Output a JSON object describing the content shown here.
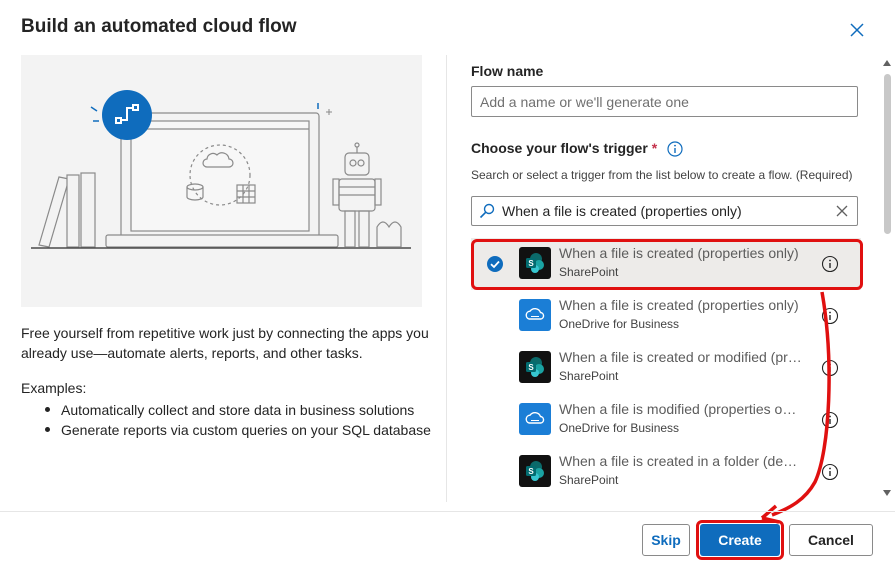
{
  "dialog": {
    "title": "Build an automated cloud flow",
    "close_icon": "close-icon"
  },
  "left": {
    "intro": "Free yourself from repetitive work just by connecting the apps you already use—automate alerts, reports, and other tasks.",
    "examples_label": "Examples:",
    "examples": [
      "Automatically collect and store data in business solutions",
      "Generate reports via custom queries on your SQL database"
    ]
  },
  "form": {
    "flow_name_label": "Flow name",
    "flow_name_value": "",
    "flow_name_placeholder": "Add a name or we'll generate one",
    "trigger_label": "Choose your flow's trigger",
    "required_marker": "*",
    "trigger_hint": "Search or select a trigger from the list below to create a flow. (Required)",
    "search_value": "When a file is created (properties only)"
  },
  "triggers": [
    {
      "title": "When a file is created (properties only)",
      "connector": "SharePoint",
      "icon": "sharepoint-icon",
      "selected": true
    },
    {
      "title": "When a file is created (properties only)",
      "connector": "OneDrive for Business",
      "icon": "onedrive-icon",
      "selected": false
    },
    {
      "title": "When a file is created or modified (properties only)",
      "connector": "SharePoint",
      "icon": "sharepoint-icon",
      "selected": false
    },
    {
      "title": "When a file is modified (properties only)",
      "connector": "OneDrive for Business",
      "icon": "onedrive-icon",
      "selected": false
    },
    {
      "title": "When a file is created in a folder (deprecated)",
      "connector": "SharePoint",
      "icon": "sharepoint-icon",
      "selected": false
    }
  ],
  "footer": {
    "skip_label": "Skip",
    "create_label": "Create",
    "cancel_label": "Cancel"
  },
  "colors": {
    "accent": "#0f6cbd",
    "highlight": "#e01010",
    "sharepoint_bg": "#111111",
    "onedrive_bg": "#1b7ed6"
  }
}
